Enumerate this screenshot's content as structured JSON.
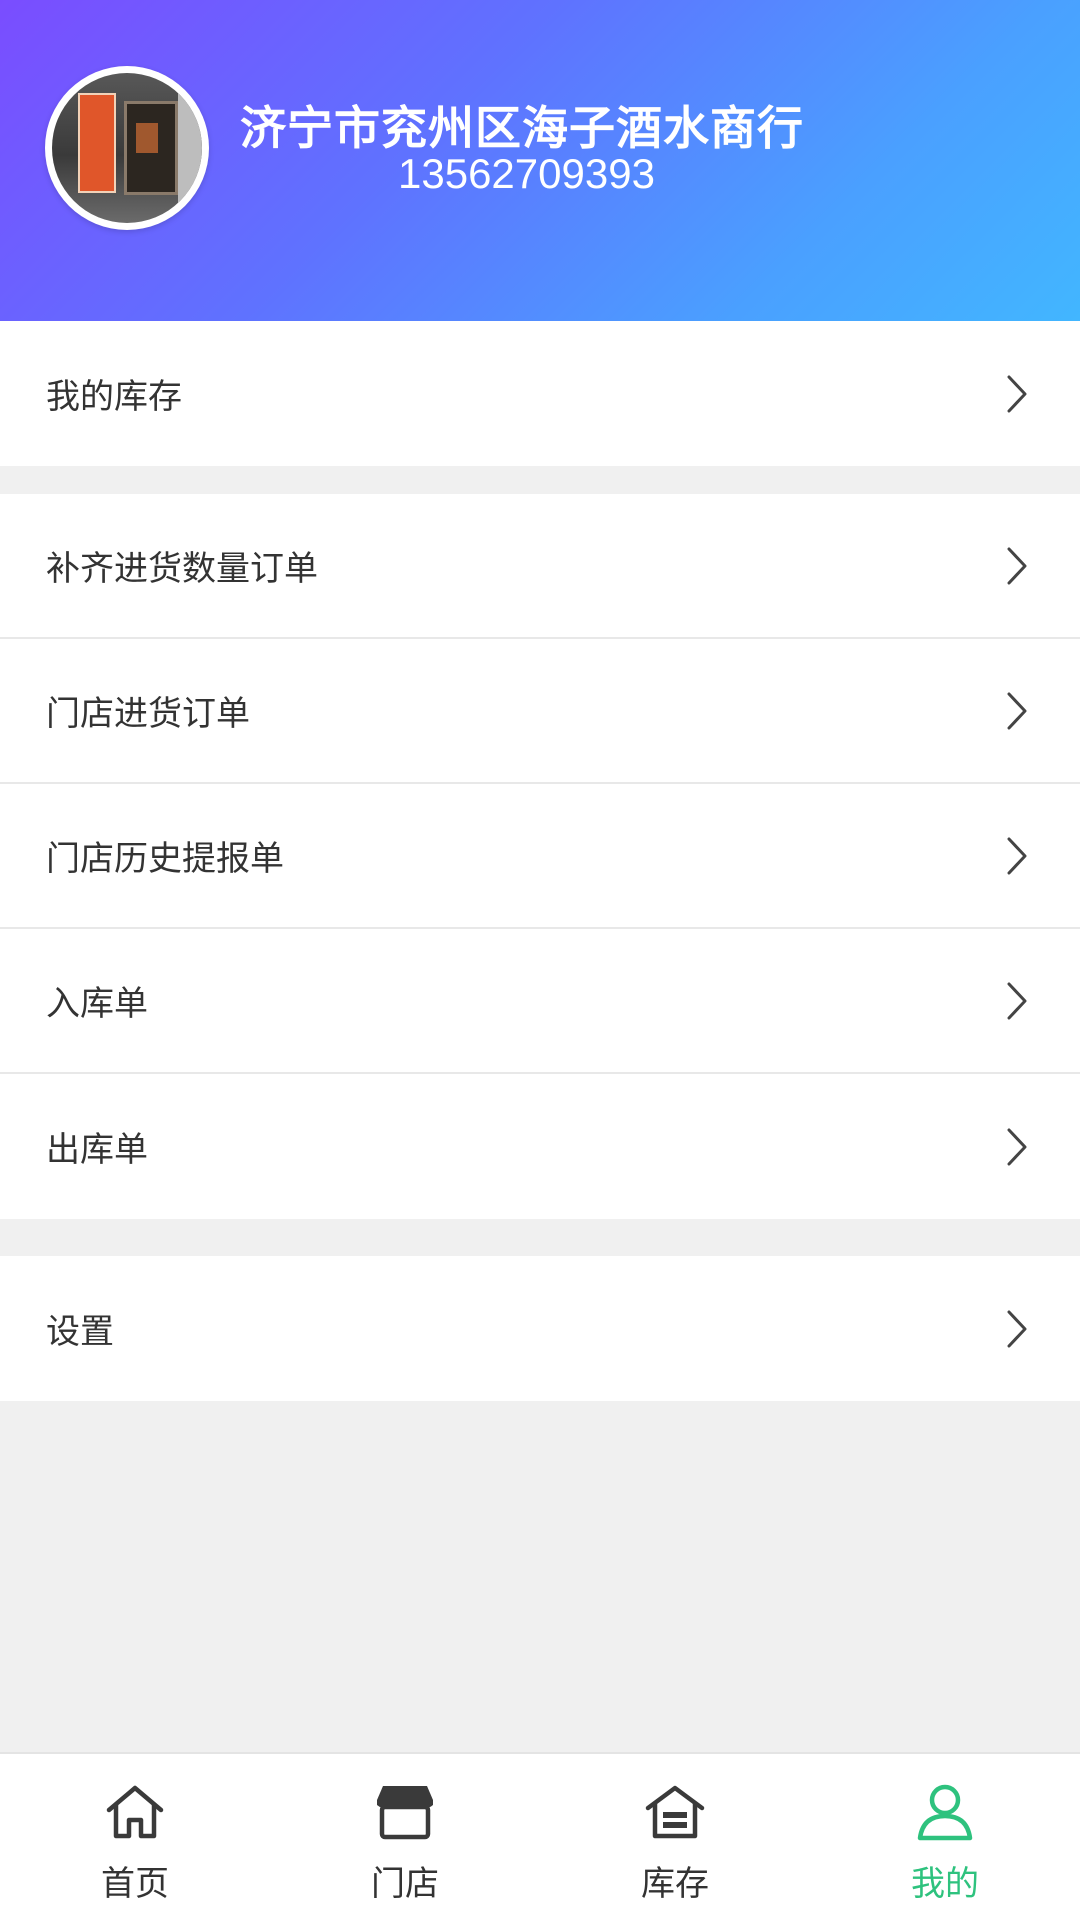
{
  "header": {
    "shop_name": "济宁市兖州区海子酒水商行",
    "phone": "13562709393"
  },
  "menu_groups": [
    {
      "items": [
        {
          "label": "我的库存"
        }
      ]
    },
    {
      "items": [
        {
          "label": "补齐进货数量订单"
        },
        {
          "label": "门店进货订单"
        },
        {
          "label": "门店历史提报单"
        },
        {
          "label": "入库单"
        },
        {
          "label": "出库单"
        }
      ]
    },
    {
      "items": [
        {
          "label": "设置"
        }
      ]
    }
  ],
  "tabbar": {
    "tabs": [
      {
        "label": "首页",
        "icon": "home-icon"
      },
      {
        "label": "门店",
        "icon": "store-icon"
      },
      {
        "label": "库存",
        "icon": "warehouse-icon"
      },
      {
        "label": "我的",
        "icon": "user-icon"
      }
    ],
    "active_index": 3
  },
  "colors": {
    "header_gradient_start": "#7a4dff",
    "header_gradient_end": "#42b6ff",
    "active_tab": "#2ec27e",
    "background": "#f0f0f0"
  }
}
